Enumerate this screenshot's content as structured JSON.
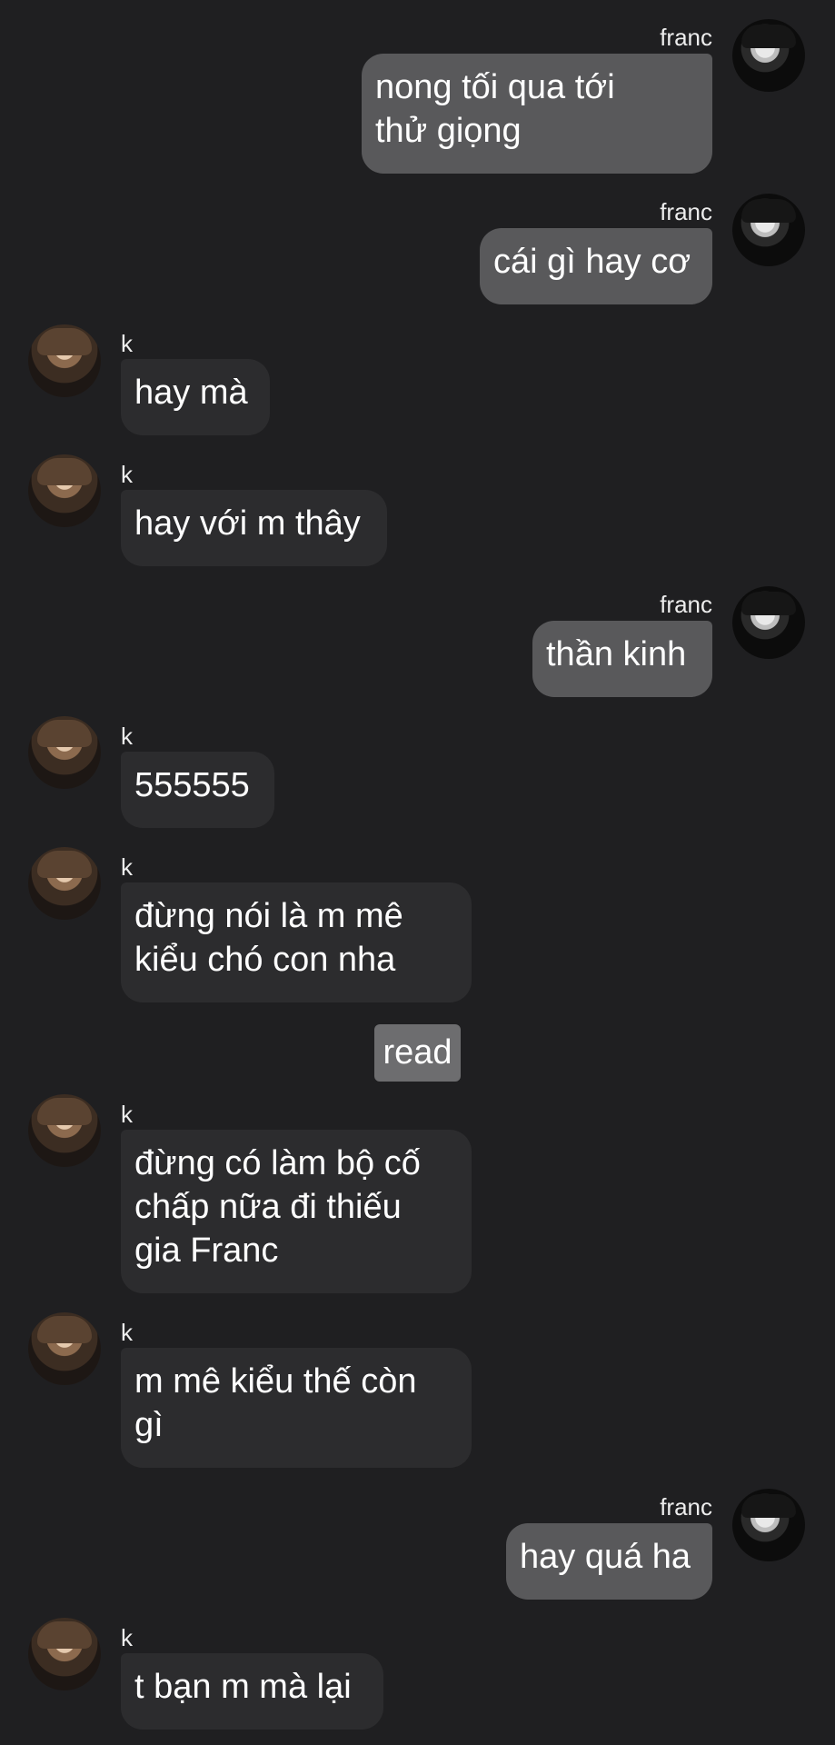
{
  "conversation": {
    "messages": [
      {
        "sender": "franc",
        "side": "right",
        "text": "nong tối qua tới\nthử giọng"
      },
      {
        "sender": "franc",
        "side": "right",
        "text": "cái gì hay cơ"
      },
      {
        "sender": "k",
        "side": "left",
        "text": "hay mà"
      },
      {
        "sender": "k",
        "side": "left",
        "text": "hay với m thây"
      },
      {
        "sender": "franc",
        "side": "right",
        "text": "thần kinh"
      },
      {
        "sender": "k",
        "side": "left",
        "text": "555555"
      },
      {
        "sender": "k",
        "side": "left",
        "text": "đừng nói là m mê\nkiểu chó con nha"
      },
      {
        "sender": "k",
        "side": "left",
        "text": "đừng có làm bộ cố\nchấp nữa đi thiếu\ngia Franc"
      },
      {
        "sender": "k",
        "side": "left",
        "text": "m mê kiểu thế còn\ngì"
      },
      {
        "sender": "franc",
        "side": "right",
        "text": "hay quá ha"
      },
      {
        "sender": "k",
        "side": "left",
        "text": "t bạn m mà lại"
      }
    ],
    "read_label": "read"
  },
  "icons": {
    "avatar_franc": "avatar-franc",
    "avatar_k": "avatar-k"
  },
  "colors": {
    "background": "#1f1f21",
    "my_bubble": "#59595b",
    "their_bubble": "#2c2c2e",
    "read_tag": "#6d6d6f"
  }
}
